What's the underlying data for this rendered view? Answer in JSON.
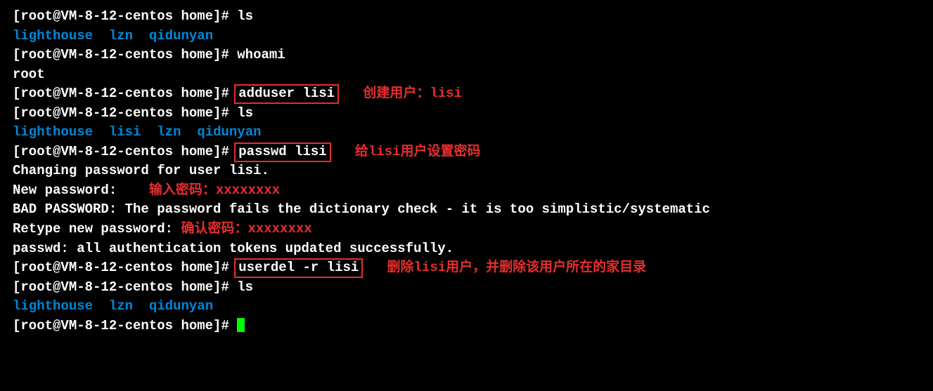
{
  "prompt": "[root@VM-8-12-centos home]# ",
  "cmd": {
    "ls": "ls",
    "whoami": "whoami",
    "adduser": "adduser lisi",
    "passwd": "passwd lisi",
    "userdel": "userdel -r lisi"
  },
  "dirs": {
    "lighthouse": "lighthouse",
    "lisi": "lisi",
    "lzn": "lzn",
    "qidunyan": "qidunyan"
  },
  "out": {
    "root": "root",
    "changing": "Changing password for user lisi.",
    "newpw": "New password: ",
    "badpw": "BAD PASSWORD: The password fails the dictionary check - it is too simplistic/systematic",
    "retype": "Retype new password: ",
    "success": "passwd: all authentication tokens updated successfully."
  },
  "ann": {
    "create": "创建用户：lisi",
    "setpw": "给lisi用户设置密码",
    "enterpw": "输入密码：xxxxxxxx",
    "confirmpw": "确认密码：xxxxxxxx",
    "deluser": "删除lisi用户，并删除该用户所在的家目录"
  },
  "sep": "  ",
  "sep3": "   ",
  "sep4": "   "
}
